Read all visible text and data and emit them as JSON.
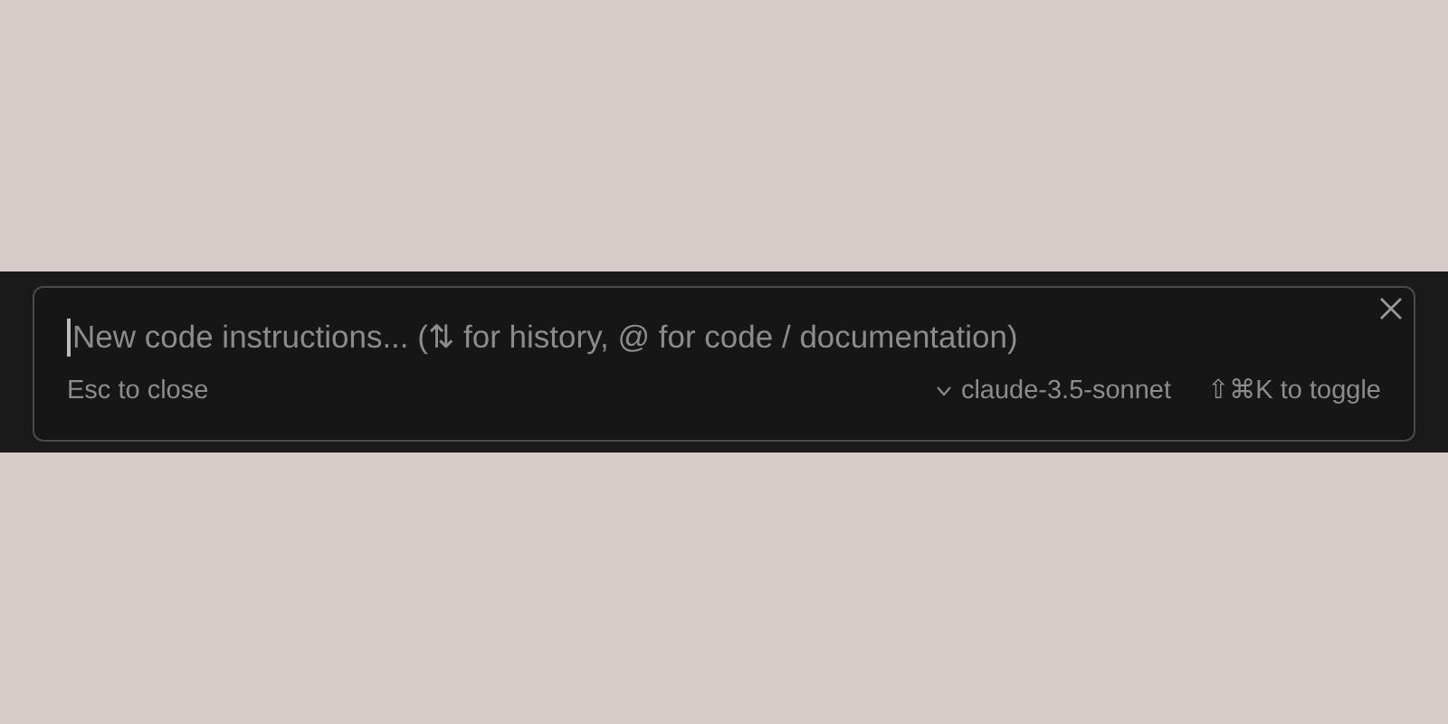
{
  "prompt": {
    "placeholder": "New code instructions... (⇅ for history, @ for code / documentation)",
    "focused": true
  },
  "footer": {
    "hint": "Esc to close",
    "model": "claude-3.5-sonnet",
    "toggle_hint": "⇧⌘K to toggle"
  }
}
